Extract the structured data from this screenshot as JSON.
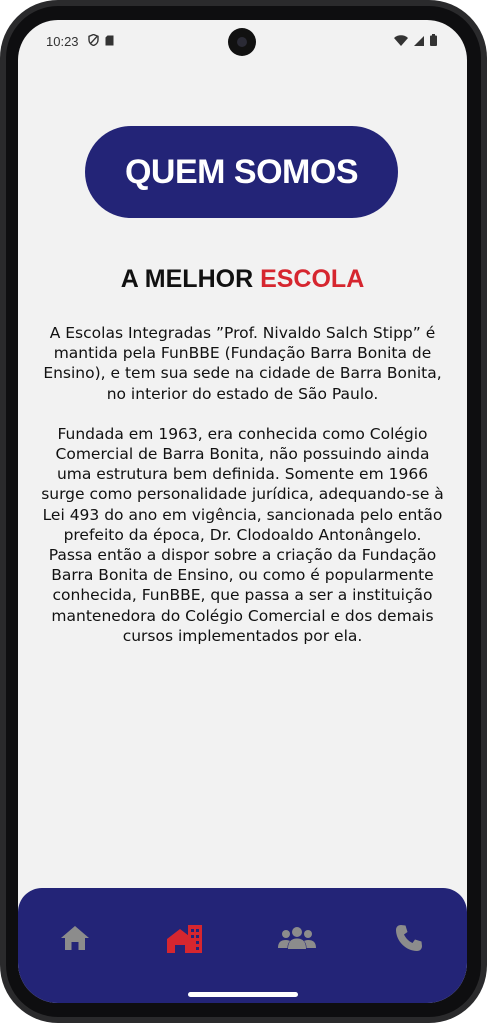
{
  "status_bar": {
    "time": "10:23"
  },
  "header": {
    "title": "QUEM SOMOS"
  },
  "section": {
    "heading_prefix": "A MELHOR ",
    "heading_accent": "ESCOLA"
  },
  "content": {
    "paragraphs": [
      "A Escolas Integradas ”Prof. Nivaldo Salch Stipp” é mantida pela FunBBE (Fundação Barra Bonita de Ensino), e tem sua sede na cidade de Barra Bonita, no interior do estado de São Paulo.",
      "Fundada em 1963, era conhecida como Colégio Comercial de Barra Bonita, não possuindo ainda uma estrutura bem definida. Somente em 1966 surge como personalidade jurídica, adequando-se à Lei 493 do ano em vigência, sancionada pelo então prefeito da época, Dr. Clodoaldo Antonângelo. Passa então a dispor sobre a criação da Fundação Barra Bonita de Ensino, ou como é popularmente conhecida, FunBBE, que passa a ser a instituição mantenedora do Colégio Comercial e dos demais cursos implementados por ela."
    ]
  },
  "bottom_nav": {
    "items": [
      {
        "icon": "home-icon",
        "active": false
      },
      {
        "icon": "building-icon",
        "active": true
      },
      {
        "icon": "users-icon",
        "active": false
      },
      {
        "icon": "phone-icon",
        "active": false
      }
    ]
  },
  "colors": {
    "primary": "#232477",
    "accent": "#d6262f",
    "inactive_icon": "#8c8c8c",
    "background": "#f2f2f2"
  }
}
